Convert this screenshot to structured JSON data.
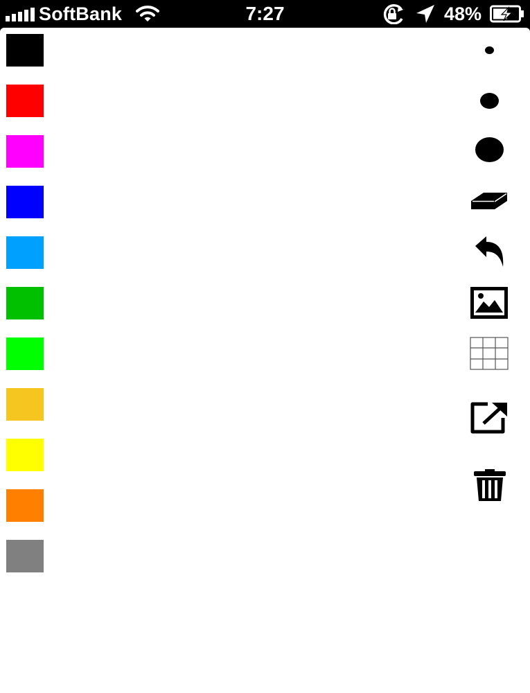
{
  "status_bar": {
    "carrier": "SoftBank",
    "time": "7:27",
    "battery": "48%",
    "icons": [
      "signal-icon",
      "wifi-icon",
      "rotation-lock-icon",
      "location-arrow-icon",
      "battery-charging-icon"
    ]
  },
  "palette": {
    "colors": [
      "#000000",
      "#ff0000",
      "#ff00ff",
      "#0000ff",
      "#00a0ff",
      "#00c000",
      "#00ff00",
      "#f5c520",
      "#ffff00",
      "#ff8000",
      "#808080"
    ]
  },
  "toolbar": {
    "icons": [
      "brush-small-icon",
      "brush-medium-icon",
      "brush-large-icon",
      "eraser-icon",
      "undo-icon",
      "image-icon",
      "grid-icon",
      "share-icon",
      "trash-icon"
    ]
  }
}
